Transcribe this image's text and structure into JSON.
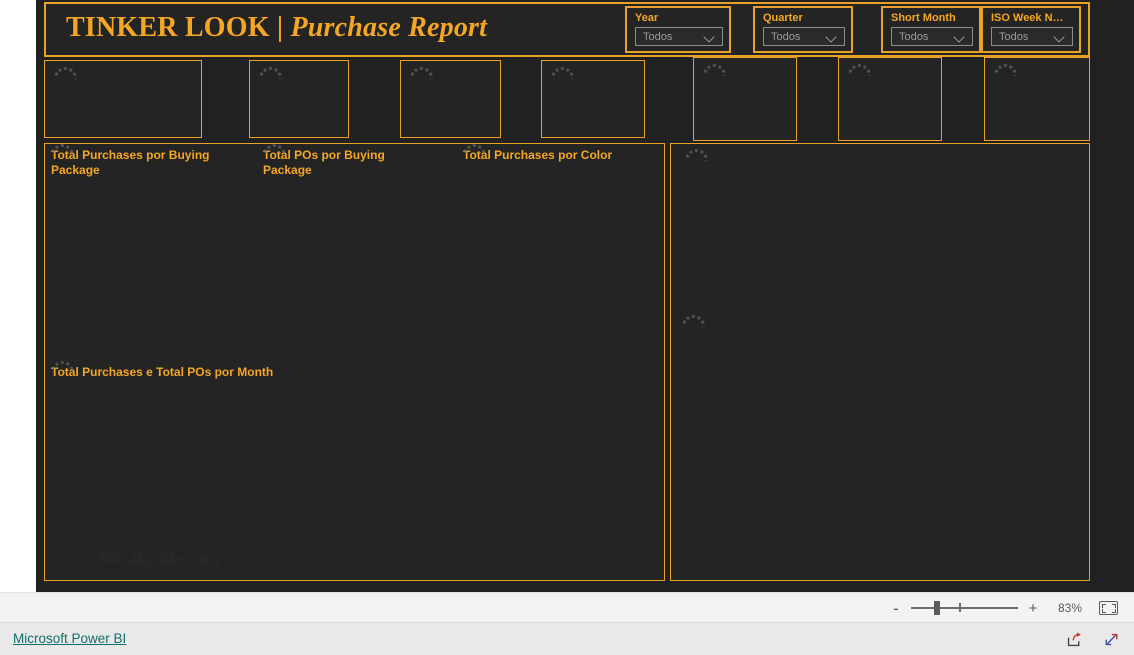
{
  "report": {
    "title_main": "TINKER LOOK |",
    "title_em": "Purchase Report",
    "watermark": "Tobi-DataDetective"
  },
  "slicers": [
    {
      "label": "Year",
      "value": "Todos",
      "icon": "chevron-down-icon"
    },
    {
      "label": "Quarter",
      "value": "Todos",
      "icon": "chevron-down-icon"
    },
    {
      "label": "Short Month",
      "value": "Todos",
      "icon": "chevron-down-icon"
    },
    {
      "label": "ISO Week N…",
      "value": "Todos",
      "icon": "chevron-down-icon"
    }
  ],
  "kpi_cards": [
    {
      "name": "kpi-card-1",
      "state": "loading"
    },
    {
      "name": "kpi-card-2",
      "state": "loading"
    },
    {
      "name": "kpi-card-3",
      "state": "loading"
    },
    {
      "name": "kpi-card-4",
      "state": "loading"
    },
    {
      "name": "kpi-card-5",
      "state": "loading"
    },
    {
      "name": "kpi-card-6",
      "state": "loading"
    },
    {
      "name": "kpi-card-7",
      "state": "loading"
    }
  ],
  "visuals": [
    {
      "title": "Total Purchases por Buying Package"
    },
    {
      "title": "Total POs por Buying Package"
    },
    {
      "title": "Total Purchases por Color"
    },
    {
      "title": "Total Purchases e Total POs por Month"
    }
  ],
  "zoombar": {
    "minus": "-",
    "plus": "+",
    "percent": "83%",
    "fit_icon": "fit-to-page-icon"
  },
  "footer": {
    "link": "Microsoft Power BI",
    "share_icon": "share-icon",
    "fullscreen_icon": "fullscreen-icon"
  },
  "colors": {
    "accent": "#E9A227",
    "title": "#F5A623",
    "canvas": "#212121",
    "panel": "#242424",
    "link": "#11706B"
  }
}
